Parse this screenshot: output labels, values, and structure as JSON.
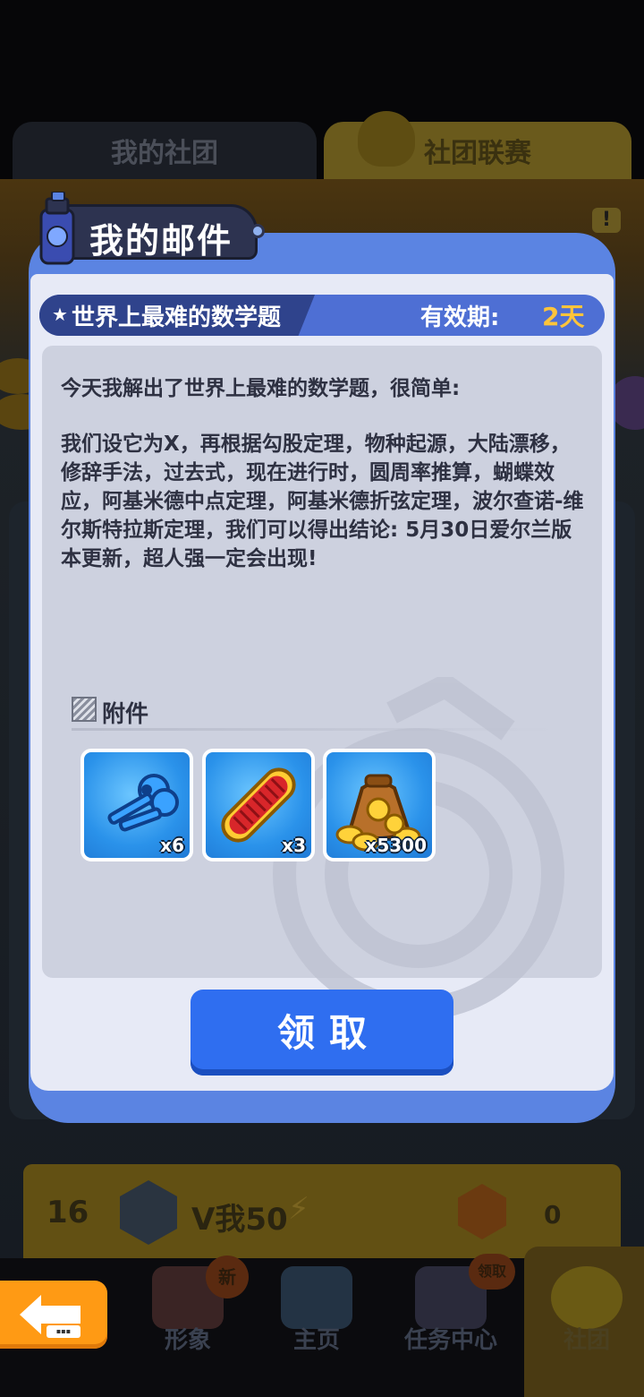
{
  "colors": {
    "dialog_blue": "#5b84e2",
    "claim_button": "#2f6ef0",
    "validity_accent": "#ffc43a",
    "back_button": "#ff9a14",
    "item_tile": "#2a92ea"
  },
  "background": {
    "tabs": [
      "我的社团",
      "社团联赛"
    ],
    "stats": {
      "rank": "16",
      "name": "V我50",
      "points": "0"
    }
  },
  "bottom_nav": [
    {
      "label": "形象",
      "badge": "新"
    },
    {
      "label": "主页",
      "badge": ""
    },
    {
      "label": "任务中心",
      "badge": "领取"
    },
    {
      "label": "社团",
      "badge": ""
    }
  ],
  "dialog": {
    "title": "我的邮件",
    "subject": "世界上最难的数学题",
    "validity_label": "有效期:",
    "validity_value": "2天",
    "body_line1": "今天我解出了世界上最难的数学题，很简单:",
    "body_line2": "我们设它为X，再根据勾股定理，物种起源，大陆漂移，修辞手法，过去式，现在进行时，圆周率推算，蝴蝶效应，阿基米德中点定理，阿基米德折弦定理，波尔查诺-维尔斯特拉斯定理，我们可以得出结论: 5月30日爱尔兰版本更新，超人强一定会出现!",
    "attachments_label": "附件",
    "attachments": [
      {
        "icon": "keys-icon",
        "count": "x6"
      },
      {
        "icon": "hoverboard-icon",
        "count": "x3"
      },
      {
        "icon": "coin-bag-icon",
        "count": "x5300"
      }
    ],
    "claim_label": "领取"
  }
}
